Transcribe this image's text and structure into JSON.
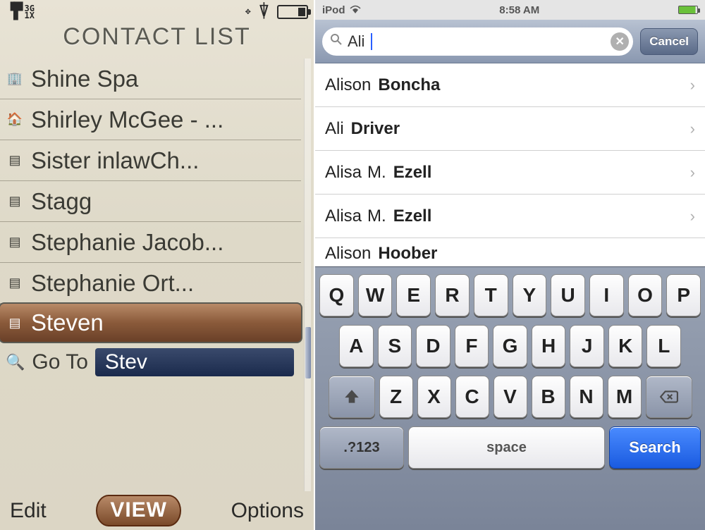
{
  "featurePhone": {
    "status": {
      "network_lines": [
        "3G",
        "1X"
      ],
      "icons": [
        "gps-icon",
        "bluetooth-icon",
        "battery-icon"
      ]
    },
    "title": "CONTACT LIST",
    "contacts": [
      {
        "icon": "building",
        "name": "Shine Spa"
      },
      {
        "icon": "home",
        "name": "Shirley McGee - ..."
      },
      {
        "icon": "sim",
        "name": "Sister inlawCh..."
      },
      {
        "icon": "sim",
        "name": "Stagg"
      },
      {
        "icon": "sim",
        "name": "Stephanie Jacob..."
      },
      {
        "icon": "sim",
        "name": "Stephanie Ort..."
      },
      {
        "icon": "sim",
        "name": "Steven",
        "selected": true
      }
    ],
    "goto": {
      "label": "Go To",
      "value": "Stev"
    },
    "softkeys": {
      "left": "Edit",
      "center": "VIEW",
      "right": "Options"
    }
  },
  "ipod": {
    "status": {
      "carrier": "iPod",
      "time": "8:58 AM"
    },
    "search": {
      "query": "Ali",
      "cancel": "Cancel"
    },
    "results": [
      {
        "first": "Alison",
        "last": "Boncha"
      },
      {
        "first": "Ali",
        "last": "Driver"
      },
      {
        "first": "Alisa",
        "middle": "M.",
        "last": "Ezell"
      },
      {
        "first": "Alisa",
        "middle": "M.",
        "last": "Ezell"
      },
      {
        "first": "Alison",
        "last": "Hoober",
        "partial": true
      }
    ],
    "keyboard": {
      "row1": [
        "Q",
        "W",
        "E",
        "R",
        "T",
        "Y",
        "U",
        "I",
        "O",
        "P"
      ],
      "row2": [
        "A",
        "S",
        "D",
        "F",
        "G",
        "H",
        "J",
        "K",
        "L"
      ],
      "row3": [
        "Z",
        "X",
        "C",
        "V",
        "B",
        "N",
        "M"
      ],
      "mode": ".?123",
      "space": "space",
      "search": "Search"
    }
  }
}
